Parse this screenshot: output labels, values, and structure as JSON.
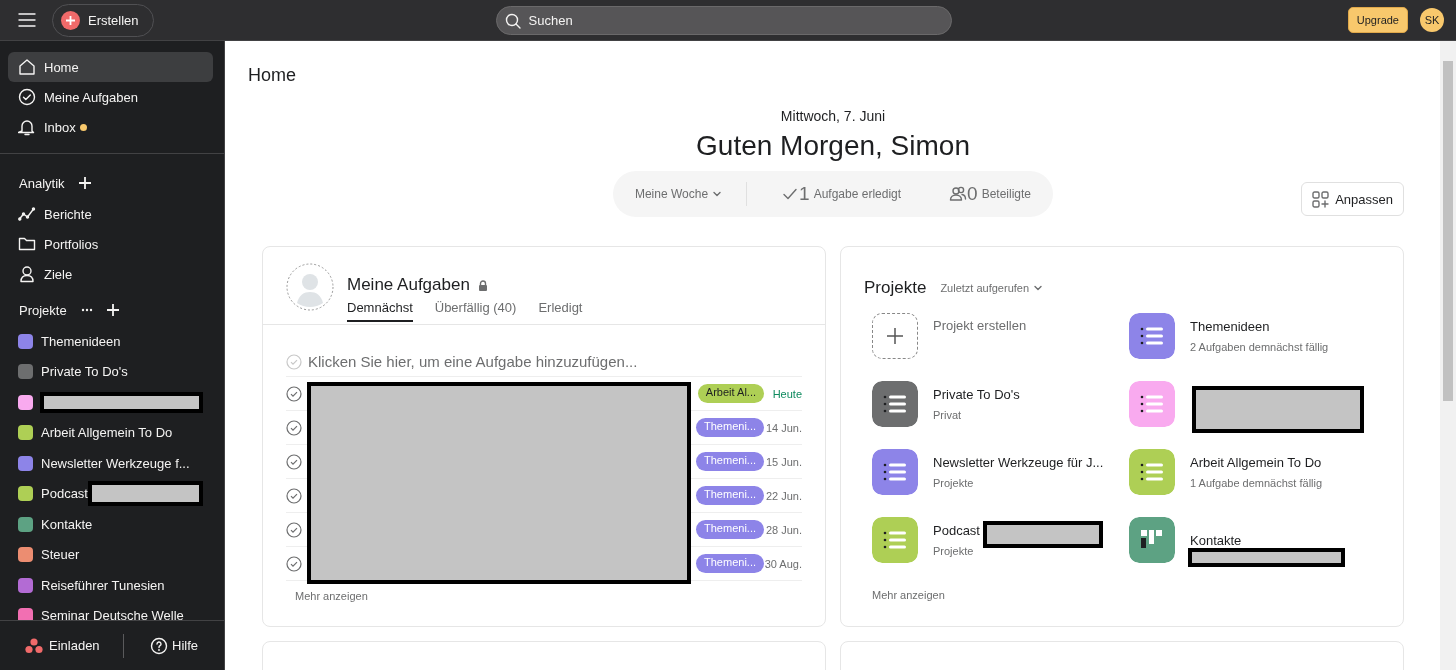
{
  "topbar": {
    "create_label": "Erstellen",
    "search_placeholder": "Suchen",
    "upgrade_label": "Upgrade",
    "avatar_initials": "SK"
  },
  "sidebar": {
    "nav": [
      {
        "label": "Home",
        "selected": true,
        "dot": false
      },
      {
        "label": "Meine Aufgaben",
        "selected": false,
        "dot": false
      },
      {
        "label": "Inbox",
        "selected": false,
        "dot": true
      }
    ],
    "analytics_heading": "Analytik",
    "analytics": [
      {
        "label": "Berichte"
      },
      {
        "label": "Portfolios"
      },
      {
        "label": "Ziele"
      }
    ],
    "projects_heading": "Projekte",
    "projects": [
      {
        "label": "Themenideen",
        "color": "#8d84e8",
        "redacted": false
      },
      {
        "label": "Private To Do's",
        "color": "#6d6e6f",
        "redacted": false
      },
      {
        "color": "#f9aaef",
        "redacted": true
      },
      {
        "label": "Arbeit Allgemein To Do",
        "color": "#aecf55",
        "redacted": false
      },
      {
        "label": "Newsletter Werkzeuge f...",
        "color": "#8d84e8",
        "redacted": false
      },
      {
        "label": "Podcast",
        "color": "#aecf55",
        "redacted": true
      },
      {
        "label": "Kontakte",
        "color": "#5da283",
        "redacted": false
      },
      {
        "label": "Steuer",
        "color": "#ec8d71",
        "redacted": false
      },
      {
        "label": "Reiseführer Tunesien",
        "color": "#b36bd4",
        "redacted": false
      },
      {
        "label": "Seminar Deutsche Welle",
        "color": "#f26fb2",
        "redacted": false
      }
    ],
    "footer": {
      "invite_label": "Einladen",
      "help_label": "Hilfe"
    }
  },
  "page": {
    "title": "Home",
    "date": "Mittwoch, 7. Juni",
    "greeting": "Guten Morgen, Simon",
    "stats": {
      "period": "Meine Woche",
      "done_count": "1",
      "done_label": "Aufgabe erledigt",
      "people_count": "0",
      "people_label": "Beteiligte"
    },
    "customize_label": "Anpassen"
  },
  "tasks_card": {
    "title": "Meine Aufgaben",
    "tabs": [
      {
        "label": "Demnächst",
        "selected": true
      },
      {
        "label": "Überfällig (40)",
        "selected": false
      },
      {
        "label": "Erledigt",
        "selected": false
      }
    ],
    "add_placeholder": "Klicken Sie hier, um eine Aufgabe hinzuzufügen...",
    "titles_redacted": true,
    "tasks": [
      {
        "completed": false,
        "project": "Arbeit Al...",
        "color": "#aecf55",
        "due": "Heute",
        "due_today": true
      },
      {
        "completed": false,
        "project": "Themeni...",
        "color": "#8d84e8",
        "due": "14 Jun.",
        "due_today": false
      },
      {
        "completed": false,
        "project": "Themeni...",
        "color": "#8d84e8",
        "due": "15 Jun.",
        "due_today": false
      },
      {
        "completed": false,
        "project": "Themeni...",
        "color": "#8d84e8",
        "due": "22 Jun.",
        "due_today": false
      },
      {
        "completed": false,
        "project": "Themeni...",
        "color": "#8d84e8",
        "due": "28 Jun.",
        "due_today": false
      },
      {
        "completed": false,
        "project": "Themeni...",
        "color": "#8d84e8",
        "due": "30 Aug.",
        "due_today": false
      }
    ],
    "more_label": "Mehr anzeigen"
  },
  "projects_card": {
    "title": "Projekte",
    "sort_label": "Zuletzt aufgerufen",
    "items": [
      {
        "kind": "create",
        "name": "Projekt erstellen"
      },
      {
        "kind": "list",
        "name": "Themenideen",
        "subtitle": "2 Aufgaben demnächst fällig",
        "color": "#8d84e8"
      },
      {
        "kind": "list",
        "name": "Private To Do's",
        "subtitle": "Privat",
        "color": "#6d6e6f"
      },
      {
        "kind": "list",
        "color": "#f9aaef",
        "redacted": true
      },
      {
        "kind": "list",
        "name": "Newsletter Werkzeuge für J...",
        "subtitle": "Projekte",
        "color": "#8d84e8"
      },
      {
        "kind": "list",
        "name": "Arbeit Allgemein To Do",
        "subtitle": "1 Aufgabe demnächst fällig",
        "color": "#aecf55"
      },
      {
        "kind": "list",
        "name": "Podcast",
        "subtitle": "Projekte",
        "color": "#aecf55",
        "redacted": true
      },
      {
        "kind": "board",
        "name": "Kontakte",
        "color": "#5da283",
        "redacted": true
      }
    ],
    "more_label": "Mehr anzeigen"
  }
}
